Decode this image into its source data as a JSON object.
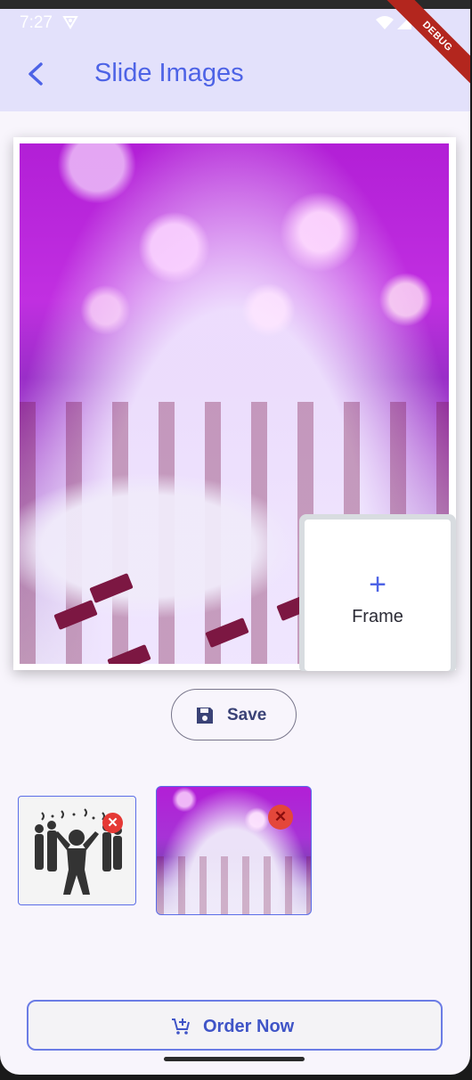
{
  "status_bar": {
    "time": "7:27",
    "debug_label": "DEBUG"
  },
  "app_bar": {
    "title": "Slide Images"
  },
  "editor": {
    "frame_label": "Frame",
    "frame_plus": "+"
  },
  "actions": {
    "save_label": "Save",
    "order_label": "Order Now"
  },
  "thumbnails": {
    "remove_glyph": "✕"
  },
  "colors": {
    "accent": "#4d63e6",
    "appbar_bg": "#e3e1fb",
    "remove_badge": "#e53935"
  }
}
